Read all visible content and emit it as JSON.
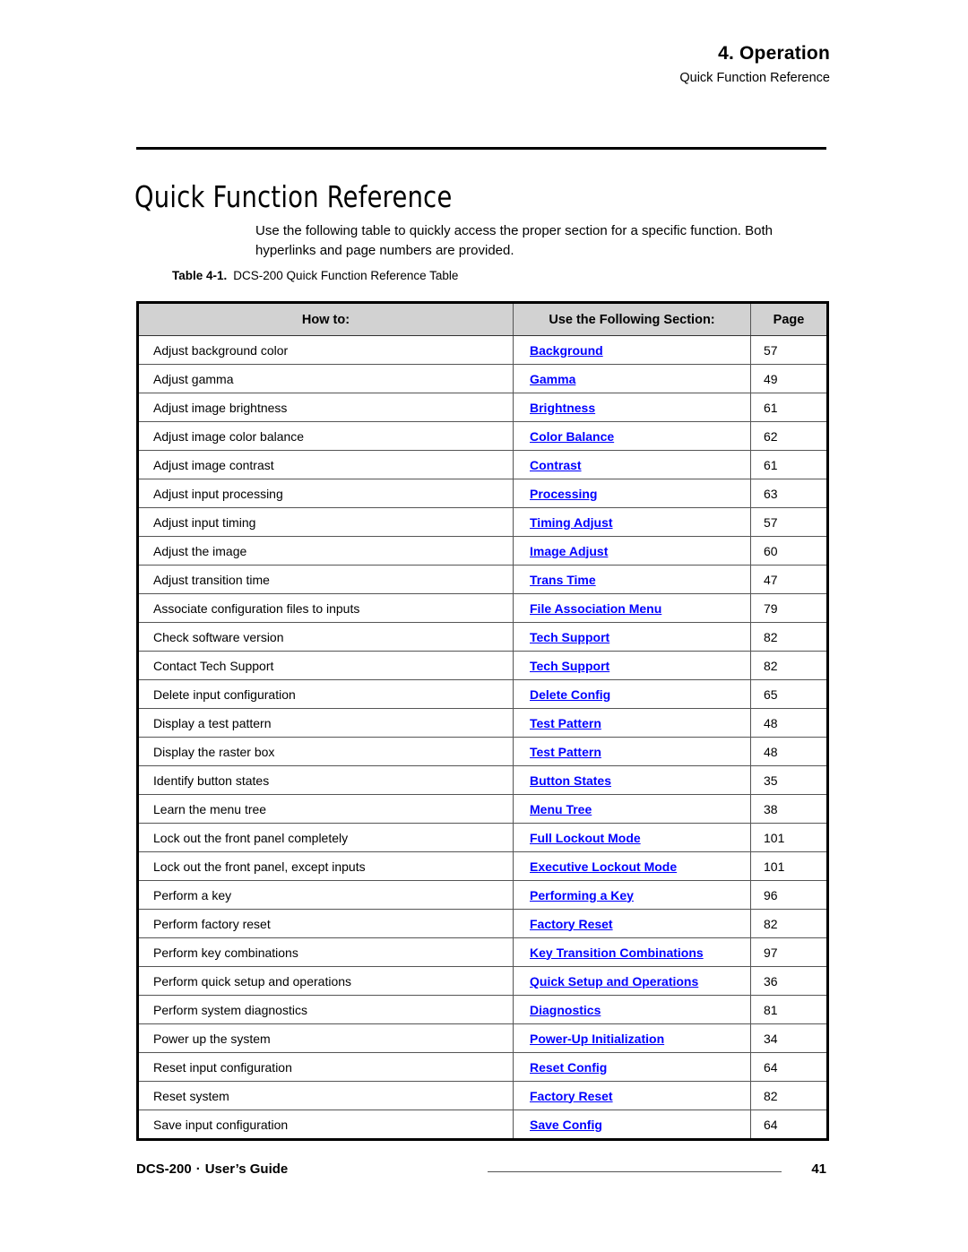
{
  "header": {
    "chapter_number": "4.",
    "chapter_title": "Operation",
    "subtitle": "Quick Function Reference"
  },
  "title": "Quick Function Reference",
  "intro": "Use the following table to quickly access the proper section for a specific function.  Both hyperlinks and page numbers are provided.",
  "caption": {
    "label": "Table 4-1.",
    "text": "DCS-200 Quick Function Reference Table"
  },
  "table": {
    "columns": [
      "How to:",
      "Use the Following Section:",
      "Page"
    ],
    "rows": [
      {
        "how": "Adjust background color",
        "section": "Background",
        "page": "57"
      },
      {
        "how": "Adjust gamma",
        "section": "Gamma",
        "page": "49"
      },
      {
        "how": "Adjust image brightness",
        "section": "Brightness",
        "page": "61"
      },
      {
        "how": "Adjust image color balance",
        "section": "Color Balance",
        "page": "62"
      },
      {
        "how": "Adjust image contrast",
        "section": "Contrast",
        "page": "61"
      },
      {
        "how": "Adjust input processing",
        "section": "Processing",
        "page": "63"
      },
      {
        "how": "Adjust input timing",
        "section": "Timing Adjust",
        "page": "57"
      },
      {
        "how": "Adjust the image",
        "section": "Image Adjust",
        "page": "60"
      },
      {
        "how": "Adjust transition time",
        "section": "Trans Time",
        "page": "47"
      },
      {
        "how": "Associate configuration files to inputs",
        "section": "File Association Menu",
        "page": "79"
      },
      {
        "how": "Check software version",
        "section": "Tech Support",
        "page": "82"
      },
      {
        "how": "Contact Tech Support",
        "section": "Tech Support",
        "page": "82"
      },
      {
        "how": "Delete input configuration",
        "section": "Delete Config",
        "page": "65"
      },
      {
        "how": "Display a test pattern",
        "section": "Test Pattern",
        "page": "48"
      },
      {
        "how": "Display the raster box",
        "section": "Test Pattern",
        "page": "48"
      },
      {
        "how": "Identify button states",
        "section": "Button States",
        "page": "35"
      },
      {
        "how": "Learn the menu tree",
        "section": "Menu Tree",
        "page": "38"
      },
      {
        "how": "Lock out the front panel completely",
        "section": "Full Lockout Mode",
        "page": "101"
      },
      {
        "how": "Lock out the front panel, except inputs",
        "section": "Executive Lockout Mode",
        "page": "101"
      },
      {
        "how": "Perform a key",
        "section": "Performing a Key",
        "page": "96"
      },
      {
        "how": "Perform factory reset",
        "section": "Factory Reset",
        "page": "82"
      },
      {
        "how": "Perform key combinations",
        "section": "Key Transition Combinations",
        "page": "97"
      },
      {
        "how": "Perform quick setup and operations",
        "section": "Quick Setup and Operations",
        "page": "36"
      },
      {
        "how": "Perform system diagnostics",
        "section": "Diagnostics",
        "page": "81"
      },
      {
        "how": "Power up the system",
        "section": "Power-Up Initialization",
        "page": "34"
      },
      {
        "how": "Reset input configuration",
        "section": "Reset Config",
        "page": "64"
      },
      {
        "how": "Reset system",
        "section": "Factory Reset",
        "page": "82"
      },
      {
        "how": "Save input configuration",
        "section": "Save Config",
        "page": "64"
      }
    ]
  },
  "footer": {
    "product": "DCS-200",
    "separator": "·",
    "document": "User’s Guide",
    "page_number": "41"
  },
  "colors": {
    "link": "#0000FF",
    "header_fill": "#D2D2D2",
    "rule": "#000000"
  }
}
